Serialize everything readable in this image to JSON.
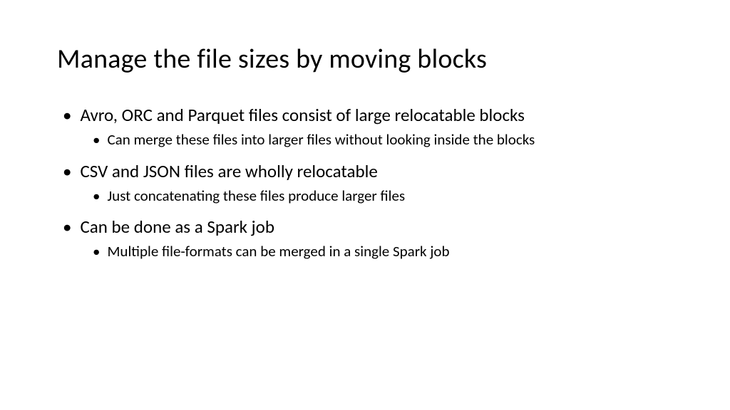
{
  "title": "Manage the file sizes by moving blocks",
  "bullets": [
    {
      "text": "Avro, ORC and Parquet files consist of large relocatable blocks",
      "sub": "Can merge these files into larger files without looking inside the blocks"
    },
    {
      "text": "CSV and JSON files are wholly relocatable",
      "sub": "Just concatenating these files produce larger files"
    },
    {
      "text": "Can be done as a Spark job",
      "sub": "Multiple file-formats can be merged in a single Spark job"
    }
  ]
}
